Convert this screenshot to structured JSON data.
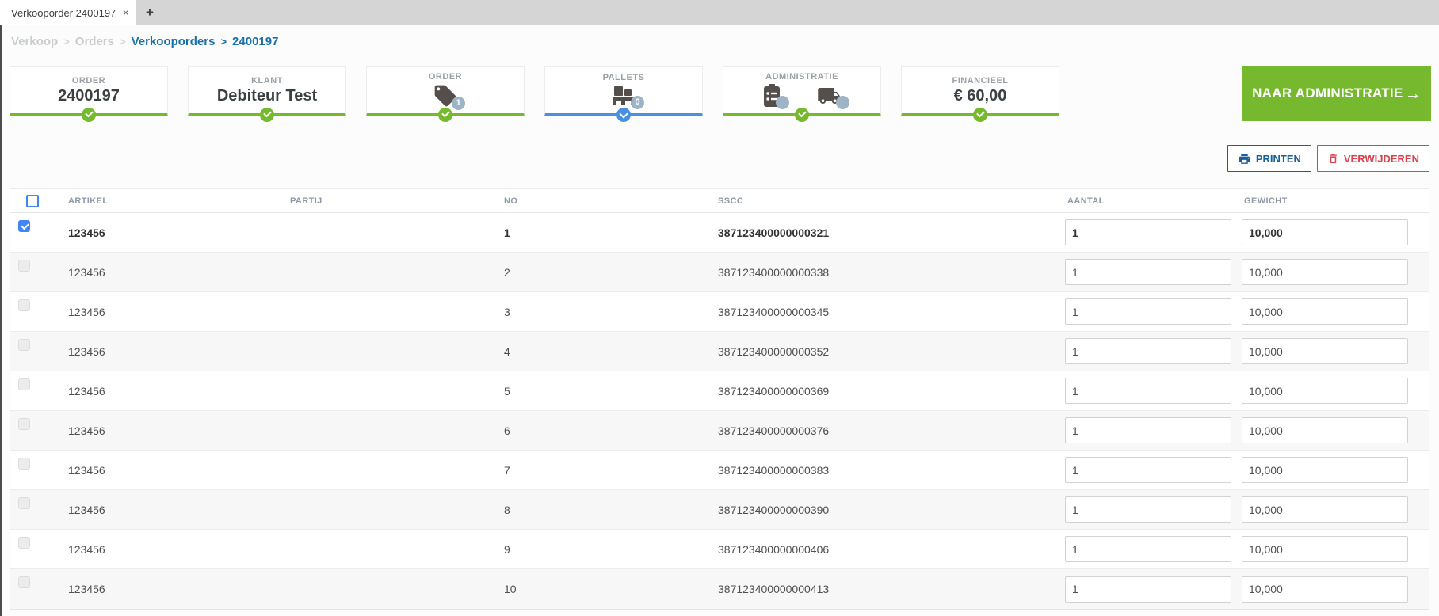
{
  "tabbar": {
    "active_tab": "Verkooporder 2400197",
    "close_glyph": "✕",
    "new_tab_glyph": "+"
  },
  "breadcrumb": {
    "separator": ">",
    "items": [
      {
        "label": "Verkoop"
      },
      {
        "label": "Orders"
      },
      {
        "label": "Verkooporders"
      },
      {
        "label": "2400197"
      }
    ]
  },
  "cards": [
    {
      "label": "ORDER",
      "value": "2400197",
      "status": "done"
    },
    {
      "label": "KLANT",
      "value": "Debiteur Test",
      "status": "done"
    },
    {
      "label": "ORDER",
      "icon": "tag-icon",
      "badge": "1",
      "status": "done"
    },
    {
      "label": "PALLETS",
      "icon": "pallet-icon",
      "badge": "0",
      "status": "active"
    },
    {
      "label": "ADMINISTRATIE",
      "icons": [
        "clipboard-icon",
        "truck-icon"
      ],
      "badge_left": "",
      "badge_right": "",
      "status": "done"
    },
    {
      "label": "FINANCIEEL",
      "value": "€ 60,00",
      "status": "done"
    }
  ],
  "actions": {
    "primary": "NAAR ADMINISTRATIE",
    "primary_arrow": "→",
    "print": "PRINTEN",
    "delete": "VERWIJDEREN"
  },
  "table": {
    "headers": {
      "artikel": "ARTIKEL",
      "partij": "PARTIJ",
      "no": "NO",
      "sscc": "SSCC",
      "aantal": "AANTAL",
      "gewicht": "GEWICHT"
    },
    "rows": [
      {
        "checked": true,
        "artikel": "123456",
        "partij": "",
        "no": "1",
        "sscc": "387123400000000321",
        "aantal": "1",
        "gewicht": "10,000"
      },
      {
        "checked": false,
        "artikel": "123456",
        "partij": "",
        "no": "2",
        "sscc": "387123400000000338",
        "aantal": "1",
        "gewicht": "10,000"
      },
      {
        "checked": false,
        "artikel": "123456",
        "partij": "",
        "no": "3",
        "sscc": "387123400000000345",
        "aantal": "1",
        "gewicht": "10,000"
      },
      {
        "checked": false,
        "artikel": "123456",
        "partij": "",
        "no": "4",
        "sscc": "387123400000000352",
        "aantal": "1",
        "gewicht": "10,000"
      },
      {
        "checked": false,
        "artikel": "123456",
        "partij": "",
        "no": "5",
        "sscc": "387123400000000369",
        "aantal": "1",
        "gewicht": "10,000"
      },
      {
        "checked": false,
        "artikel": "123456",
        "partij": "",
        "no": "6",
        "sscc": "387123400000000376",
        "aantal": "1",
        "gewicht": "10,000"
      },
      {
        "checked": false,
        "artikel": "123456",
        "partij": "",
        "no": "7",
        "sscc": "387123400000000383",
        "aantal": "1",
        "gewicht": "10,000"
      },
      {
        "checked": false,
        "artikel": "123456",
        "partij": "",
        "no": "8",
        "sscc": "387123400000000390",
        "aantal": "1",
        "gewicht": "10,000"
      },
      {
        "checked": false,
        "artikel": "123456",
        "partij": "",
        "no": "9",
        "sscc": "387123400000000406",
        "aantal": "1",
        "gewicht": "10,000"
      },
      {
        "checked": false,
        "artikel": "123456",
        "partij": "",
        "no": "10",
        "sscc": "387123400000000413",
        "aantal": "1",
        "gewicht": "10,000"
      }
    ]
  },
  "colors": {
    "accent_green": "#76b82e",
    "accent_blue": "#4a90e2",
    "checkbox_blue": "#4285f4",
    "link_blue": "#1b6fa8",
    "print_blue": "#1a5f96",
    "danger_red": "#d9414e",
    "icon_dark": "#544f4a",
    "badge_gray": "#9db4c7"
  }
}
